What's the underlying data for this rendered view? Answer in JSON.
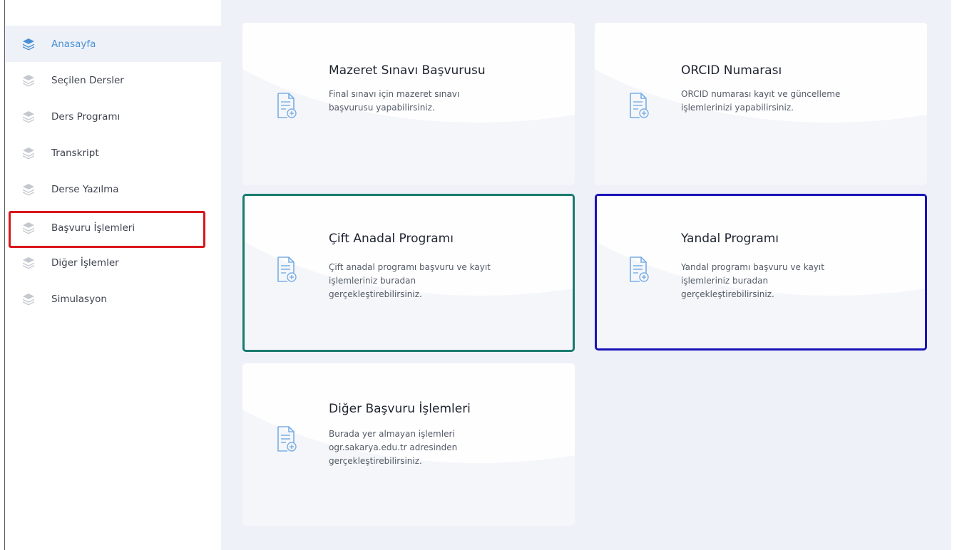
{
  "sidebar": {
    "items": [
      {
        "label": "Anasayfa",
        "icon": "layers-icon",
        "active": true
      },
      {
        "label": "Seçilen Dersler",
        "icon": "layers-icon"
      },
      {
        "label": "Ders Programı",
        "icon": "layers-icon"
      },
      {
        "label": "Transkript",
        "icon": "layers-icon"
      },
      {
        "label": "Derse Yazılma",
        "icon": "layers-icon"
      },
      {
        "label": "Başvuru İşlemleri",
        "icon": "layers-icon",
        "highlighted": true
      },
      {
        "label": "Diğer İşlemler",
        "icon": "layers-icon"
      },
      {
        "label": "Simulasyon",
        "icon": "layers-icon"
      }
    ]
  },
  "cards": [
    {
      "title": "Mazeret Sınavı Başvurusu",
      "line1": "Final sınavı için mazeret sınavı",
      "line2": "başvurusu yapabilirsiniz.",
      "line3": "",
      "icon": "document-add-icon"
    },
    {
      "title": "ORCID Numarası",
      "line1": "ORCID numarası kayıt ve güncelleme",
      "line2": "işlemlerinizi yapabilirsiniz.",
      "line3": "",
      "icon": "document-add-icon"
    },
    {
      "title": "Çift Anadal Programı",
      "line1": "Çift anadal programı başvuru ve kayıt",
      "line2": "işlemleriniz buradan",
      "line3": "gerçekleştirebilirsiniz.",
      "icon": "document-add-icon",
      "highlight_color": "#1a7a6e"
    },
    {
      "title": "Yandal Programı",
      "line1": "Yandal programı başvuru ve kayıt",
      "line2": "işlemleriniz buradan",
      "line3": "gerçekleştirebilirsiniz.",
      "icon": "document-add-icon",
      "highlight_color": "#1a14b8"
    },
    {
      "title": "Diğer Başvuru İşlemleri",
      "line1": "Burada yer almayan işlemleri",
      "line2": "ogr.sakarya.edu.tr adresinden",
      "line3": "gerçekleştirebilirsiniz.",
      "icon": "document-add-icon"
    }
  ],
  "colors": {
    "accent": "#4a8fd6",
    "sidebar_highlight": "#d9161c",
    "main_bg": "#eef1f7"
  }
}
